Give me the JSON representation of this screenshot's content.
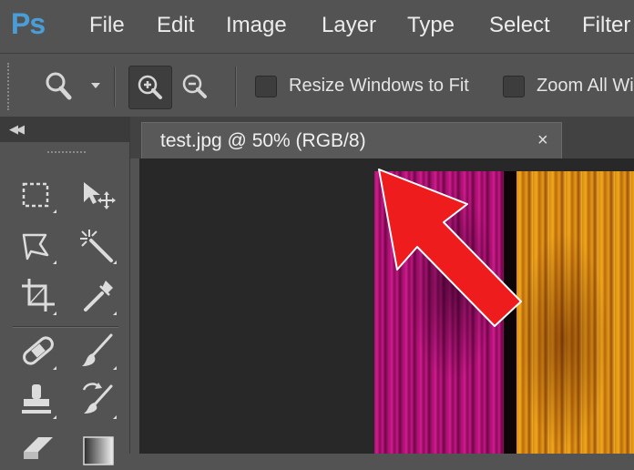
{
  "app": {
    "logo": "Ps"
  },
  "menu": {
    "items": [
      "File",
      "Edit",
      "Image",
      "Layer",
      "Type",
      "Select",
      "Filter"
    ]
  },
  "options": {
    "resize_windows_label": "Resize Windows to Fit",
    "zoom_all_label": "Zoom All Wi"
  },
  "document": {
    "tab_title": "test.jpg @ 50% (RGB/8)",
    "close_glyph": "×"
  },
  "colors": {
    "ui_background": "#535353",
    "canvas_background": "#282828",
    "logo_blue": "#4a9ed8",
    "annotation_arrow": "#ee1c1c"
  },
  "icons": {
    "options": [
      "zoom-tool-icon",
      "dropdown-arrow-icon",
      "zoom-in-icon",
      "zoom-out-icon"
    ],
    "tools": [
      "rectangular-marquee-icon",
      "move-tool-icon",
      "lasso-icon",
      "magic-wand-icon",
      "crop-icon",
      "eyedropper-icon",
      "healing-brush-icon",
      "brush-icon",
      "clone-stamp-icon",
      "history-brush-icon",
      "eraser-icon",
      "gradient-icon"
    ]
  }
}
